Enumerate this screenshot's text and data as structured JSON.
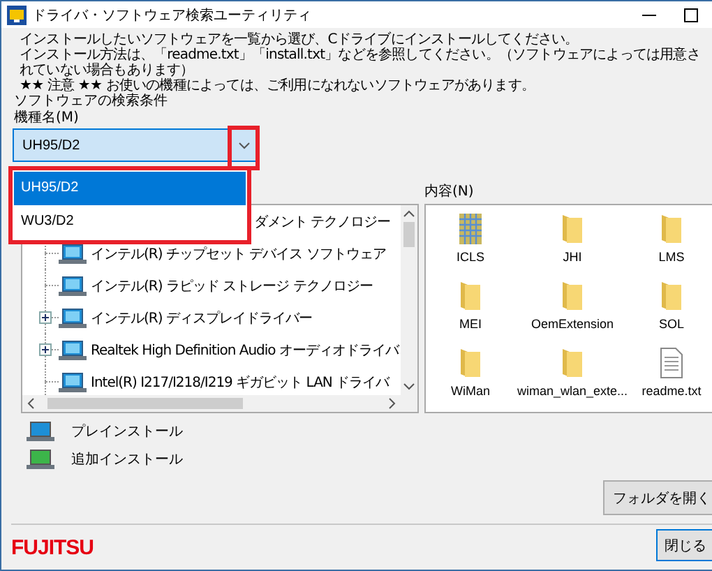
{
  "window": {
    "title": "ドライバ・ソフトウェア検索ユーティリティ"
  },
  "intro": [
    "インストールしたいソフトウェアを一覧から選び、Cドライブにインストールしてください。",
    "インストール方法は、「readme.txt」「install.txt」などを参照してください。（ソフトウェアによっては用意されていない場合もあります）",
    "★★ 注意 ★★ お使いの機種によっては、ご利用になれないソフトウェアがあります。"
  ],
  "search": {
    "title": "ソフトウェアの検索条件",
    "model_label": "機種名(M)",
    "model_value": "UH95/D2",
    "open": true,
    "options": [
      {
        "label": "UH95/D2",
        "selected": true
      },
      {
        "label": "WU3/D2",
        "selected": false
      }
    ]
  },
  "software_tree": [
    {
      "label": "ダメント テクノロジー",
      "expander": false
    },
    {
      "label": "インテル(R) チップセット デバイス ソフトウェア",
      "expander": false
    },
    {
      "label": "インテル(R) ラピッド ストレージ テクノロジー",
      "expander": false
    },
    {
      "label": "インテル(R) ディスプレイドライバー",
      "expander": true
    },
    {
      "label": "Realtek High Definition Audio オーディオドライバ",
      "expander": true
    },
    {
      "label": "Intel(R) I217/I218/I219 ギガビット LAN ドライバ",
      "expander": false
    }
  ],
  "contents": {
    "label": "内容(N)",
    "items": [
      {
        "name": "ICLS",
        "kind": "grid-file"
      },
      {
        "name": "JHI",
        "kind": "folder"
      },
      {
        "name": "LMS",
        "kind": "folder"
      },
      {
        "name": "MEI",
        "kind": "folder"
      },
      {
        "name": "OemExtension",
        "kind": "folder"
      },
      {
        "name": "SOL",
        "kind": "folder"
      },
      {
        "name": "WiMan",
        "kind": "folder"
      },
      {
        "name": "wiman_wlan_exte...",
        "kind": "folder"
      },
      {
        "name": "readme.txt",
        "kind": "text-file"
      }
    ]
  },
  "legend": [
    {
      "label": "プレインストール",
      "color": "#1e8fd6"
    },
    {
      "label": "追加インストール",
      "color": "#3cb54a"
    }
  ],
  "buttons": {
    "open_folder": "フォルダを開く",
    "close": "閉じる"
  },
  "logo": "FUJITSU"
}
